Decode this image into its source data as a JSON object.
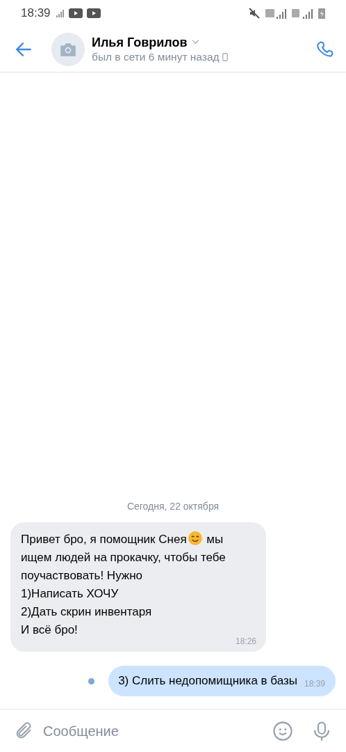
{
  "status_bar": {
    "time": "18:39"
  },
  "header": {
    "name": "Илья Говрилов",
    "status": "был в сети 6 минут назад"
  },
  "date_separator": "Сегодня, 22 октября",
  "messages": [
    {
      "kind": "incoming",
      "segments": [
        {
          "kind": "text",
          "text": "Привет бро, я помощник Снея"
        },
        {
          "kind": "emoji"
        },
        {
          "kind": "text",
          "text": " мы ищем людей на прокачку, чтобы тебе поучаствовать! Нужно\n1)Написать ХОЧУ\n2)Дать скрин инвентаря\nИ всё бро!"
        }
      ],
      "time": "18:26"
    },
    {
      "kind": "outgoing",
      "segments": [
        {
          "kind": "text",
          "text": "3) Слить недопомищника в базы"
        }
      ],
      "time": "18:39",
      "unread": true
    }
  ],
  "composer": {
    "placeholder": "Сообщение"
  }
}
